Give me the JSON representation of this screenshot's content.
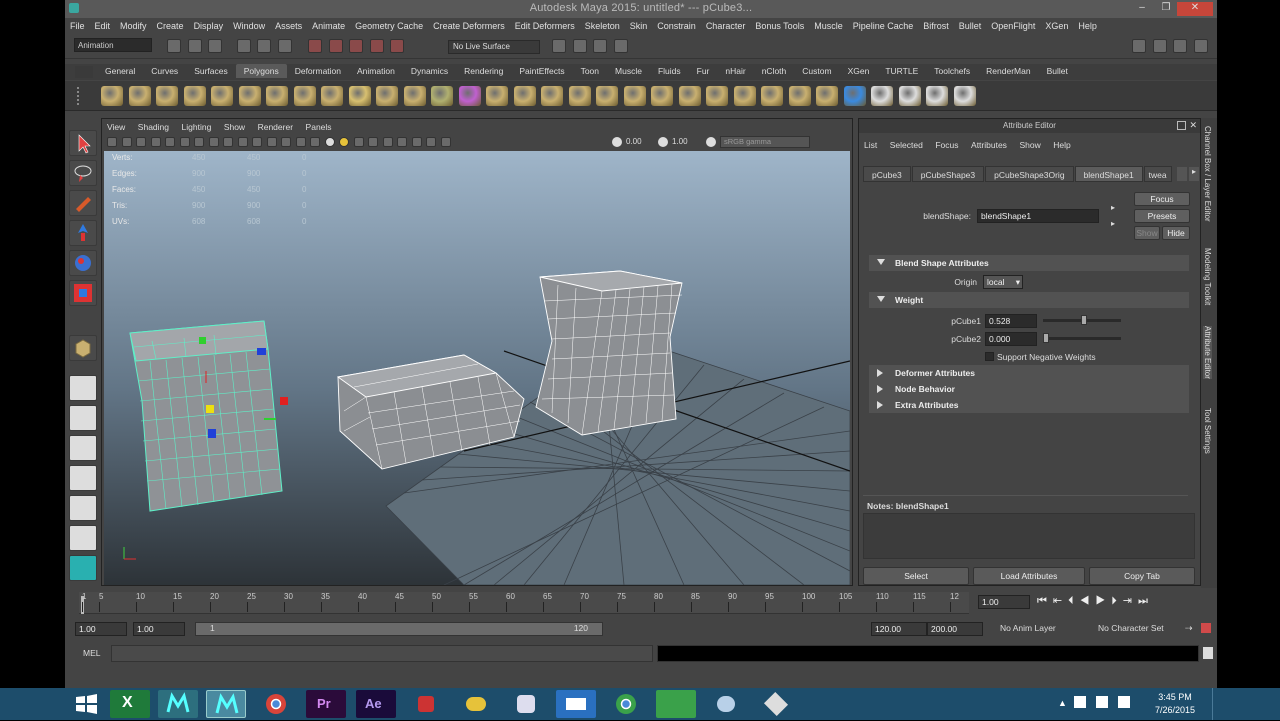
{
  "title": "Autodesk Maya 2015: untitled*   ---   pCube3...",
  "window_buttons": [
    "–",
    "❐",
    "✕"
  ],
  "menubar": [
    "File",
    "Edit",
    "Modify",
    "Create",
    "Display",
    "Window",
    "Assets",
    "Animate",
    "Geometry Cache",
    "Create Deformers",
    "Edit Deformers",
    "Skeleton",
    "Skin",
    "Constrain",
    "Character",
    "Bonus Tools",
    "Muscle",
    "Pipeline Cache",
    "Bifrost",
    "Bullet",
    "OpenFlight",
    "XGen",
    "Help"
  ],
  "status": {
    "mode": "Animation",
    "live_surface": "No Live Surface"
  },
  "shelf_tabs": [
    "General",
    "Curves",
    "Surfaces",
    "Polygons",
    "Deformation",
    "Animation",
    "Dynamics",
    "Rendering",
    "PaintEffects",
    "Toon",
    "Muscle",
    "Fluids",
    "Fur",
    "nHair",
    "nCloth",
    "Custom",
    "XGen",
    "TURTLE",
    "Toolchefs",
    "RenderMan",
    "Bullet"
  ],
  "shelf_selected": "Polygons",
  "viewport": {
    "menu": [
      "View",
      "Shading",
      "Lighting",
      "Show",
      "Renderer",
      "Panels"
    ],
    "exposure": "0.00",
    "gamma": "1.00",
    "colorspace": "sRGB gamma",
    "hud": [
      {
        "k": "Verts:",
        "a": "450",
        "b": "450",
        "c": "0"
      },
      {
        "k": "Edges:",
        "a": "900",
        "b": "900",
        "c": "0"
      },
      {
        "k": "Faces:",
        "a": "450",
        "b": "450",
        "c": "0"
      },
      {
        "k": "Tris:",
        "a": "900",
        "b": "900",
        "c": "0"
      },
      {
        "k": "UVs:",
        "a": "608",
        "b": "608",
        "c": "0"
      }
    ]
  },
  "attr": {
    "title": "Attribute Editor",
    "menu": [
      "List",
      "Selected",
      "Focus",
      "Attributes",
      "Show",
      "Help"
    ],
    "tabs": [
      "pCube3",
      "pCubeShape3",
      "pCubeShape3Orig",
      "blendShape1",
      "twea"
    ],
    "tab_selected": "blendShape1",
    "node_label": "blendShape:",
    "node_value": "blendShape1",
    "btn_focus": "Focus",
    "btn_presets": "Presets",
    "btn_show": "Show",
    "btn_hide": "Hide",
    "sec_blend": "Blend Shape Attributes",
    "origin_label": "Origin",
    "origin_value": "local",
    "sec_weight": "Weight",
    "w1_label": "pCube1",
    "w1_value": "0.528",
    "w1_weight": 0.528,
    "w2_label": "pCube2",
    "w2_value": "0.000",
    "w2_weight": 0,
    "support_neg": "Support Negative Weights",
    "sec_deformer": "Deformer Attributes",
    "sec_node": "Node Behavior",
    "sec_extra": "Extra Attributes",
    "notes": "Notes: blendShape1",
    "btn_select": "Select",
    "btn_load": "Load Attributes",
    "btn_copy": "Copy Tab"
  },
  "side_tabs": [
    "Channel Box / Layer Editor",
    "Modeling Toolkit",
    "Attribute Editor",
    "Tool Settings"
  ],
  "timeline": {
    "ticks": [
      "1",
      "5",
      "10",
      "15",
      "20",
      "25",
      "30",
      "35",
      "40",
      "45",
      "50",
      "55",
      "60",
      "65",
      "70",
      "75",
      "80",
      "85",
      "90",
      "95",
      "100",
      "105",
      "110",
      "115",
      "12"
    ],
    "current": "1.00"
  },
  "range": {
    "start_a": "1.00",
    "start_b": "1.00",
    "inner_start": "1",
    "inner_end": "120",
    "end_a": "120.00",
    "end_b": "200.00",
    "anim_layer": "No Anim Layer",
    "char_set": "No Character Set"
  },
  "cmd": {
    "label": "MEL"
  },
  "taskbar": {
    "time": "3:45 PM",
    "date": "7/26/2015"
  }
}
